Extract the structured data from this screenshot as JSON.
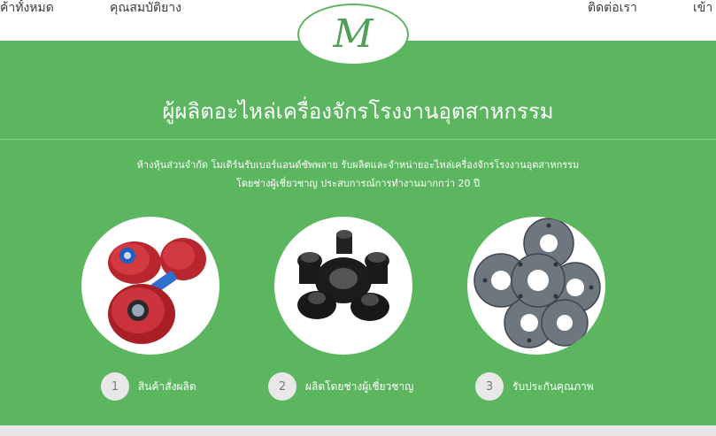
{
  "nav": {
    "all_products": "ค้าทั้งหมด",
    "properties": "คุณสมบัติยาง",
    "contact": "ติดต่อเรา",
    "login": "เข้า"
  },
  "logo": {
    "letter": "M"
  },
  "hero": {
    "title": "ผู้ผลิตอะไหล่เครื่องจักรโรงงานอุตสาหกรรม",
    "desc_line1": "ห้างหุ้นส่วนจำกัด โมเดิร์นรับเบอร์แอนด์ซัพพลาย รับผลิตและจำหน่ายอะไหล่เครื่องจักรโรงงานอุตสาหกรรม",
    "desc_line2": "โดยช่างผู้เชี่ยวชาญ ประสบการณ์การทำงานมากกว่า 20 ปี"
  },
  "features": [
    {
      "number": "1",
      "label": "สินค้าสั่งผลิต",
      "image": "red-rollers-image"
    },
    {
      "number": "2",
      "label": "ผลิตโดยช่างผู้เชี่ยวชาญ",
      "image": "black-couplings-image"
    },
    {
      "number": "3",
      "label": "รับประกันคุณภาพ",
      "image": "gray-flanges-image"
    }
  ],
  "colors": {
    "brand_green": "#5cb55f",
    "white": "#ffffff",
    "badge_gray": "#e8e8e8"
  }
}
